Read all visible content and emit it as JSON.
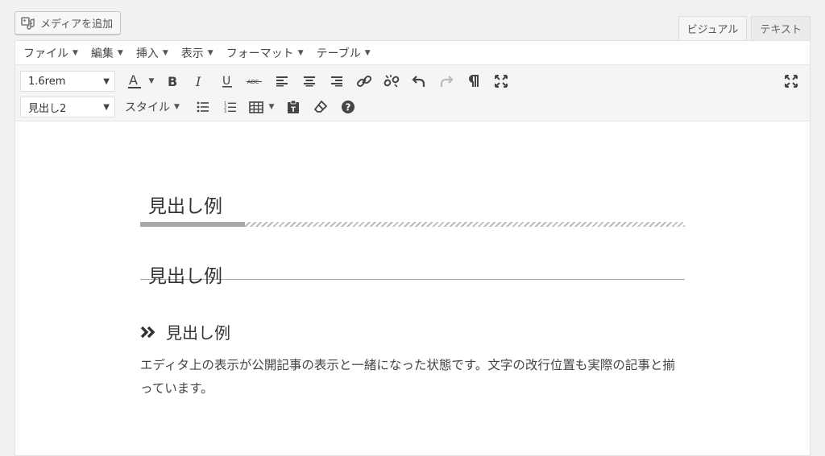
{
  "media_button": {
    "label": "メディアを追加"
  },
  "mode_tabs": [
    {
      "label": "ビジュアル",
      "active": true
    },
    {
      "label": "テキスト",
      "active": false
    }
  ],
  "menubar": [
    "ファイル",
    "編集",
    "挿入",
    "表示",
    "フォーマット",
    "テーブル"
  ],
  "toolbar": {
    "font_size": "1.6rem",
    "block_format": "見出し2",
    "style_menu": "スタイル"
  },
  "content": {
    "heading1": "見出し例",
    "heading2": "見出し例",
    "heading3": "見出し例",
    "paragraph": "エディタ上の表示が公開記事の表示と一緒になった状態です。文字の改行位置も実際の記事と揃っています。"
  }
}
